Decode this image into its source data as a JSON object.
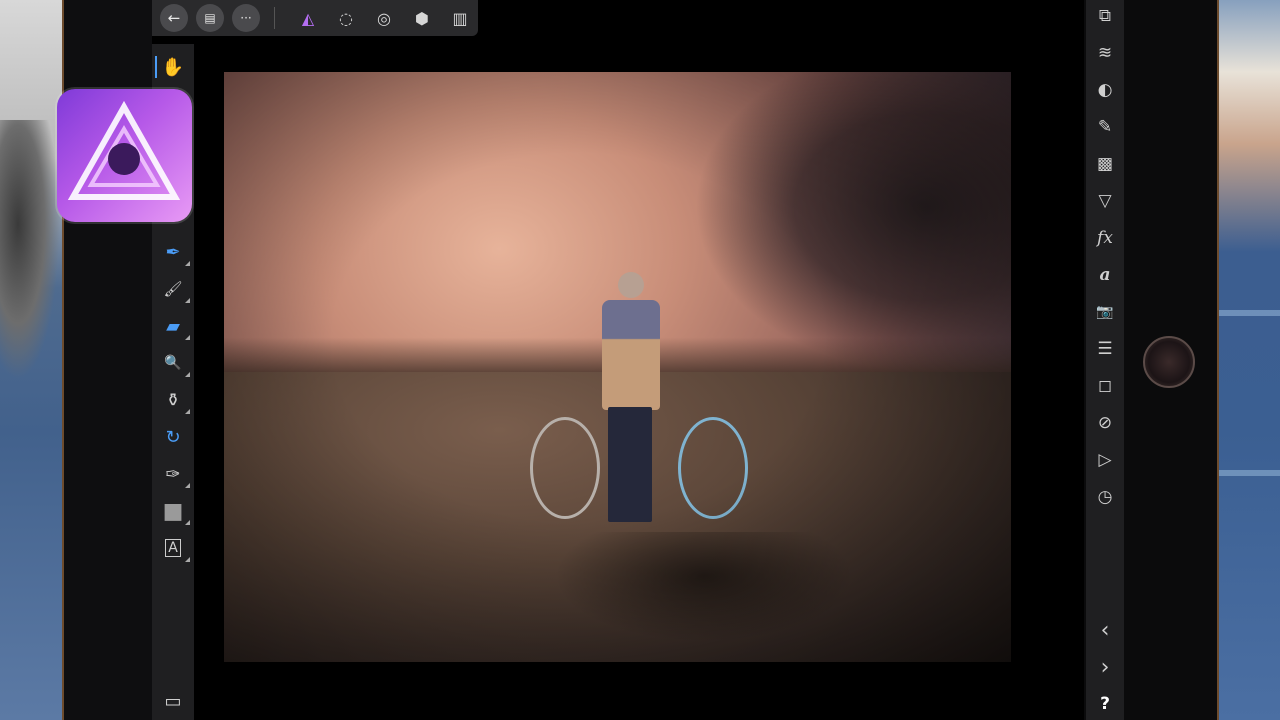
{
  "app": {
    "name": "Affinity Photo",
    "logo_icon": "affinity-photo-logo"
  },
  "top_toolbar": {
    "back_icon": "←",
    "document_icon": "▤",
    "more_icon": "···",
    "personas": [
      {
        "name": "photo-persona",
        "glyph": "◭"
      },
      {
        "name": "selection-persona",
        "glyph": "◌"
      },
      {
        "name": "liquify-persona",
        "glyph": "◎"
      },
      {
        "name": "develop-persona",
        "glyph": "⬢"
      },
      {
        "name": "tone-map-persona",
        "glyph": "▥"
      }
    ]
  },
  "left_tools": [
    {
      "name": "hand-tool",
      "glyph": "✋",
      "active": true
    },
    {
      "name": "color-picker-tool",
      "glyph": "✒"
    },
    {
      "name": "paint-brush-tool",
      "glyph": "🖌"
    },
    {
      "name": "eraser-tool",
      "glyph": "▰"
    },
    {
      "name": "dodge-tool",
      "glyph": "🔍"
    },
    {
      "name": "clone-tool",
      "glyph": "⚱"
    },
    {
      "name": "undo-brush-tool",
      "glyph": "↻"
    },
    {
      "name": "pen-tool",
      "glyph": "✑"
    },
    {
      "name": "rectangle-tool",
      "glyph": "■"
    },
    {
      "name": "text-tool",
      "glyph": "A"
    },
    {
      "name": "quick-mask-tool",
      "glyph": "▭"
    }
  ],
  "right_studio": [
    {
      "name": "navigator-icon",
      "glyph": "⧉"
    },
    {
      "name": "layers-icon",
      "glyph": "≋"
    },
    {
      "name": "color-icon",
      "glyph": "◐"
    },
    {
      "name": "brushes-icon",
      "glyph": "✎"
    },
    {
      "name": "channels-icon",
      "glyph": "▩"
    },
    {
      "name": "filters-icon",
      "glyph": "▽"
    },
    {
      "name": "fx-icon",
      "glyph": "fx"
    },
    {
      "name": "text-styles-icon",
      "glyph": "a"
    },
    {
      "name": "camera-icon",
      "glyph": "📷"
    },
    {
      "name": "adjustments-icon",
      "glyph": "☰"
    },
    {
      "name": "transform-icon",
      "glyph": "◻"
    },
    {
      "name": "block-icon",
      "glyph": "⊘"
    },
    {
      "name": "macro-icon",
      "glyph": "▷"
    },
    {
      "name": "history-icon",
      "glyph": "◷"
    },
    {
      "name": "collapse-left-icon",
      "glyph": "‹"
    },
    {
      "name": "collapse-right-icon",
      "glyph": "›"
    },
    {
      "name": "help-icon",
      "glyph": "?"
    }
  ],
  "colors": {
    "accent": "#4b9cf5",
    "toolbar_bg": "#2a2a2c",
    "panel_bg": "#1f1f21"
  }
}
